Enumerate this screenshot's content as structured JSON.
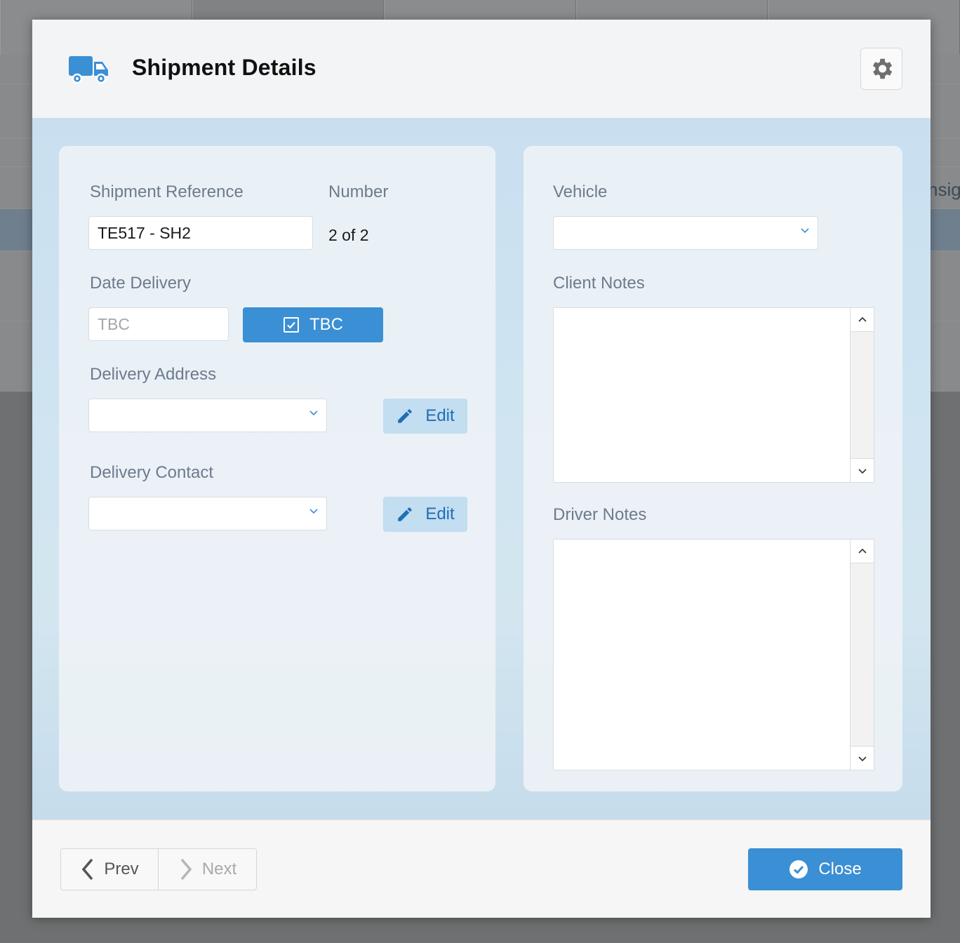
{
  "background": {
    "partial_text": "nsigr"
  },
  "modal": {
    "title": "Shipment Details",
    "header_icon": "truck-icon",
    "settings_icon": "gear-icon"
  },
  "left_panel": {
    "shipment_reference_label": "Shipment Reference",
    "shipment_reference_value": "TE517 - SH2",
    "number_label": "Number",
    "number_value": "2 of 2",
    "date_delivery_label": "Date Delivery",
    "date_delivery_placeholder": "TBC",
    "tbc_button_label": "TBC",
    "delivery_address_label": "Delivery Address",
    "delivery_address_value": "",
    "delivery_address_edit_label": "Edit",
    "delivery_contact_label": "Delivery Contact",
    "delivery_contact_value": "",
    "delivery_contact_edit_label": "Edit"
  },
  "right_panel": {
    "vehicle_label": "Vehicle",
    "vehicle_value": "",
    "client_notes_label": "Client Notes",
    "client_notes_value": "",
    "driver_notes_label": "Driver Notes",
    "driver_notes_value": ""
  },
  "footer": {
    "prev_label": "Prev",
    "next_label": "Next",
    "close_label": "Close"
  },
  "colors": {
    "accent": "#3b8fd4",
    "edit_bg": "#c3ddf1",
    "label": "#6d7b8c"
  }
}
